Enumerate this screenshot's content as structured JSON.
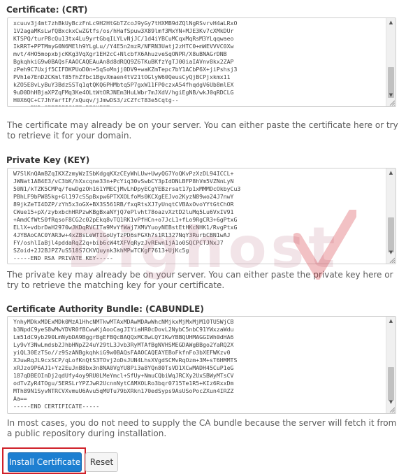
{
  "crt": {
    "label": "Certificate: (CRT)",
    "text": "xcuuv3j4mt7zhBkUyBczFnLc9H2HtGbTZcoJ9yGy7tHXMB9dZQlNgRSvrvH4aLRxO\n1V2agaMKsLwfQBxckxCwZGtfs/os/hHafSpuw3X89lmf3MxYN+MJE3Kv7cXMkDUr\nKTSPQ/turP8cQu13tx4Lu9yrtGbqILYLvNjJC/1d4iYBCuMCqxMqRsM3YLqqwaeo\nIkRRT+PPTMmyG0N6MElh9YLgLu//Y4E5n2mzR/NFRN3Uatj2zHTC0+mWEVVVC0Xw\nmvt/4HO5mopxbjcKKg3VqXgr1EH2cC+NlcbfX6AhuzveSqONPR/X8uBNAGrDNB\nBgkqhkiG9w0BAQsFAAOCAQEAuAn8d8dRQQ9Z6TKuBKfzYgTJ00iaIAVnv8kx2ZAP\nzPeh9C7Uxjf5CIFDKPUoD0n+5qSoMnjj0DV9+waKZmTepc7bY1ACbP6X+jiPshsj3\nPVh1e7EnD2CKmlf85fhZfbc1BgvXmaen4tV21tOGlyW60QeusCyQjBCPjxkmx11\nkZO5E8vLyBuY3BdzSSTq1qtQKQ6PHMbtq5P7gxW11FP0czxA54fhqdgV6Ub8mlEX\n9uD0DhHBjaXPZqFMq3Ke4OLtWtORJNEm3HuLWbr7mJXdV/hgiEgNB/wkJ0qRDCLG\nH0X6QC+C7JhYarfIF/xQuqv/jJmwDS3/zCZfcT83e5Cqtg--\n-----END CERTIFICATE REQUEST-----",
    "help": "The certificate may already be on your server. You can either paste the certificate here or try to retrieve it for your domain."
  },
  "key": {
    "label": "Private Key (KEY)",
    "text": "W7SlKnQAmBZqIKXZzmyWzISbKdgqKXzCEyWhLUw+UwyQG7YoQKvPzXzDL94ICCL+\nJWNat1AB4E3/vC3bK/hXxcqne33n+PcYiq30vSwbCY3pIdDNLBFP8hVm5VZNnLyN\n50N1/kTZK5CMPq/fewDgzOh161YMECjMvLhDpyECgYEBzrsat17p1xMMMDcOkbyCu3\nPBhLF9bPW85kg+Gl197cSSpBxpw6PTXXOLfoMs0KCXgEEJvo2KyzN89wo24J7nwY\n89jkZeTI4DZP/zYh5x3oGX+BX3S561RB/fxqRtsXJ7yUnqtCVBAxOvoYYtGtChOR\nCWue15+pX/zybxbchHRPzwKBgBxaNYjQ7ePlvht78oazvXztD2luMq5Lu6VxIV91\n+AmdCfWtS0fRqsoF8CG2c02pEkq8vTQ1RK1vPfHCn+o7JcL1+fLo9RgCR3+6gPtxG\nELlX+vdbrDaH2970wJKDqRVCITa9MvYfWaj7XMVYuoyNEBstEtHKcNHK1/RvgPtxG\n4JYBAoCAC0YAR3w+4xZBsLeWTIGoUyTzPD6sFGXh7s1R1327NqY3RurbCBN1wAJ\nFY/oshlIaBjl4pddaRqZ2q+bib6cW4tXFVqRyzJvREwn1jA1o0SQCPCTJNxJ7\nSZoid+2J2BJPZ7uS518S7CKVQuynk3khMPwTCKgF7613+UjKc5g\n-----END RSA PRIVATE KEY-----",
    "help": "The private key may already be on your server. You can either paste the private key here or try to retrieve the matching key for your certificate."
  },
  "cabundle": {
    "label": "Certificate Authority Bundle: (CABUNDLE)",
    "text": "YnhyMDkxMDExMDk0MzA1HhcNMTkwMTAxMDAwMDAwWhcNMjkxMjMxMjM1OTU5WjCB\nb3NpdC9yeS8wMwYDVR0fBCwwKjAooCagJIYiaHR0cDovL2NybC5nbC91YWxzaWdu\nLm51dC9yb290LmNybDA9BggrBgEFBQcBAQQxMC8wLQYIKwYBBQUHMAGGIWh0dHA6\nLy9vY3NwLmdsb2JhbHNpZ24uY29tL3Jvb3RyMTAfBgNVHSMEGDAWgBBgo2YaRQ2X\nyiQL30EzTSo//z9SzANBgkqhkiG9w0BAQsFAAOCAQEAYEBoFkfnFo3bXEFWKzv0\nXJuwRqJL9cxSCP/qLofKnQtS3TOvj2oDsJUN4LhsXVgdSCMvRqOzm+3M+sT6HMMTS\nxRJzo9P6AJ1+Yz2EuJnB8bx3n8NA0VgYU8Pi3a8YQn80TsVD1XCwMADH45CuP1eG\n187qDBEOInDj2qdUfy4oy9RU0LMeYmcl+SfUy+NmuCQbiWqJRCXy2UxSBWyMTsCV\nodTvZyR4TOgu/5ERSLrYPZJwR2UcnnNytCAMXOLRo3bqr0715Te1R5+KIz6RxxDm\nMTh89N1SyvNTRCVXvmuU6Avu5qMUTu79bXRkn170edSyps9AsUSoPocZXun4IRZZ\nAa==\n-----END CERTIFICATE-----",
    "help": "In most cases, you do not need to supply the CA bundle because the server will fetch it from a public repository during installation."
  },
  "watermark": "Dighost",
  "buttons": {
    "install": "Install Certificate",
    "reset": "Reset"
  },
  "colors": {
    "primary": "#1d7fd1",
    "highlight": "#d0212a"
  }
}
